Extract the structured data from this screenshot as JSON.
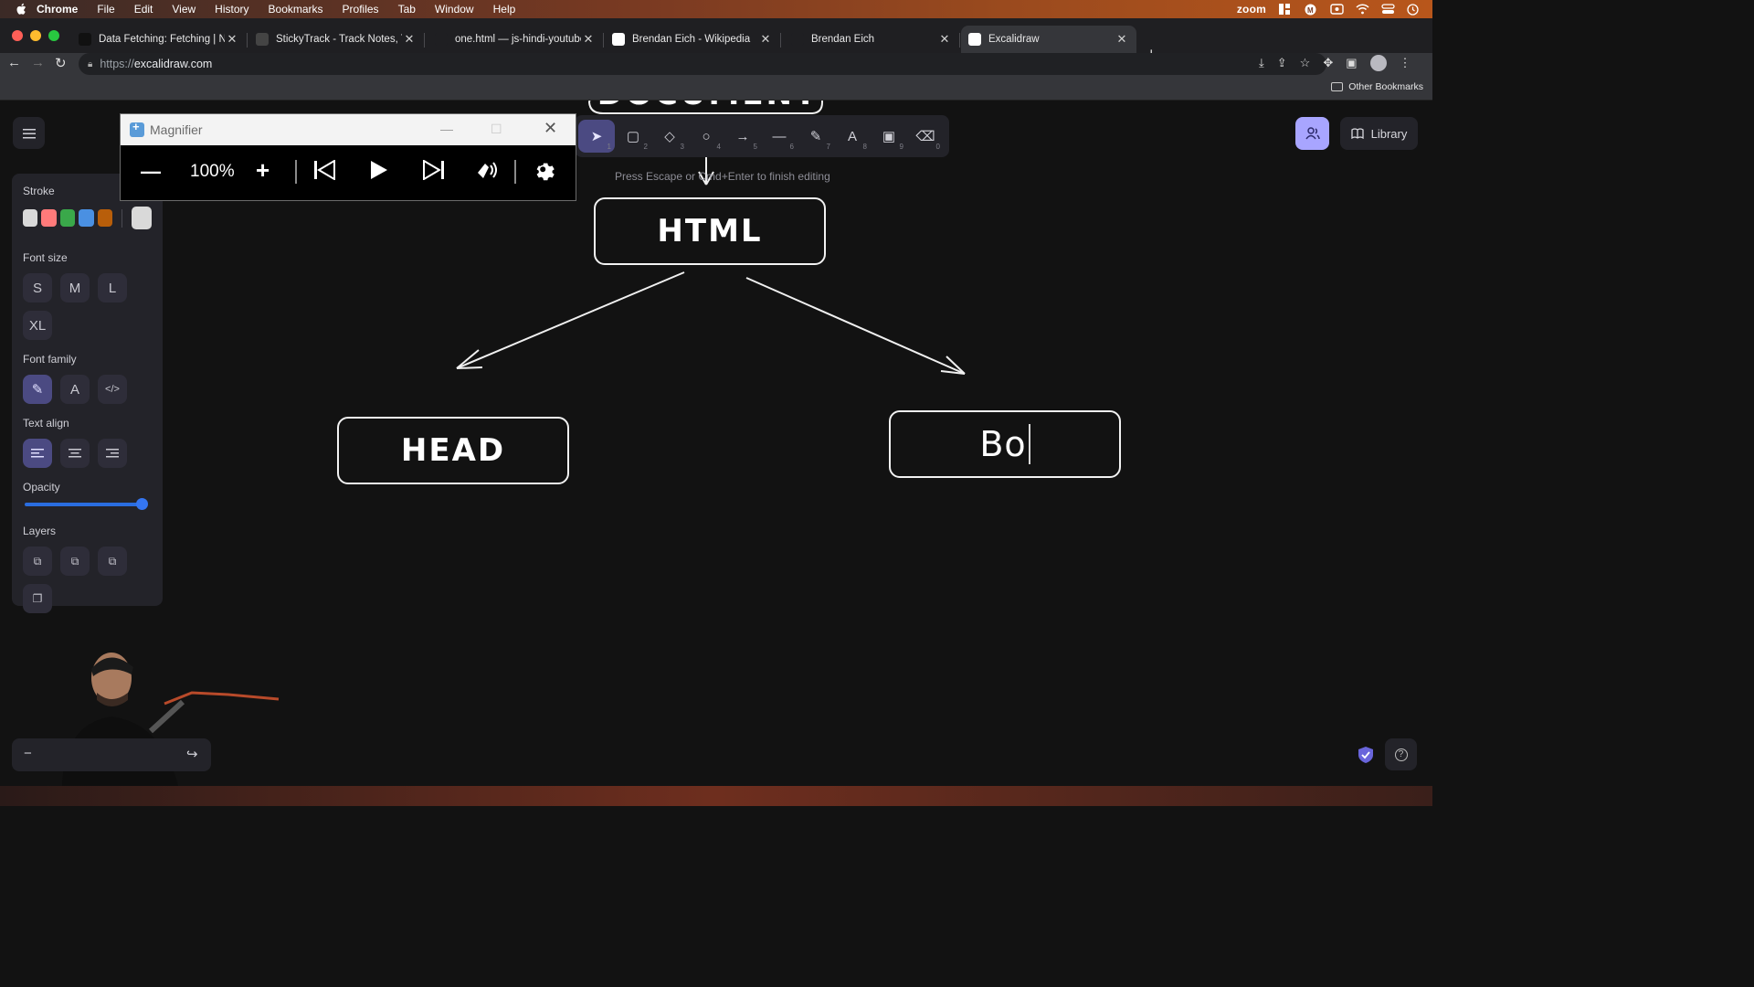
{
  "menubar": {
    "app": "Chrome",
    "items": [
      "File",
      "Edit",
      "View",
      "History",
      "Bookmarks",
      "Profiles",
      "Tab",
      "Window",
      "Help"
    ],
    "right_label": "zoom"
  },
  "tabs": [
    {
      "title": "Data Fetching: Fetching | Next",
      "favicon_color": "#111111",
      "active": false
    },
    {
      "title": "StickyTrack - Track Notes, Trac",
      "favicon_color": "#444444",
      "active": false
    },
    {
      "title": "one.html — js-hindi-youtube [C",
      "favicon_color": "#1f1f22",
      "active": false
    },
    {
      "title": "Brendan Eich - Wikipedia",
      "favicon_color": "#ffffff",
      "active": false
    },
    {
      "title": "Brendan Eich",
      "favicon_color": "#1f1f22",
      "active": false
    },
    {
      "title": "Excalidraw",
      "favicon_color": "#ffffff",
      "active": true
    }
  ],
  "address": {
    "protocol": "https://",
    "host": "excalidraw.com"
  },
  "bookmarks": {
    "other": "Other Bookmarks"
  },
  "properties": {
    "stroke_label": "Stroke",
    "stroke_colors": [
      "#d9d9d9",
      "#ff7a7a",
      "#3aa84a",
      "#4a90e2",
      "#b85e0a"
    ],
    "stroke_current": "#d9d9d9",
    "font_size_label": "Font size",
    "font_sizes": [
      "S",
      "M",
      "L",
      "XL"
    ],
    "font_family_label": "Font family",
    "text_align_label": "Text align",
    "opacity_label": "Opacity",
    "opacity_value": 100,
    "layers_label": "Layers"
  },
  "tools": [
    {
      "name": "selection",
      "key": "1",
      "glyph": "➤"
    },
    {
      "name": "rectangle",
      "key": "2",
      "glyph": "▢"
    },
    {
      "name": "diamond",
      "key": "3",
      "glyph": "◇"
    },
    {
      "name": "ellipse",
      "key": "4",
      "glyph": "○"
    },
    {
      "name": "arrow",
      "key": "5",
      "glyph": "→"
    },
    {
      "name": "line",
      "key": "6",
      "glyph": "—"
    },
    {
      "name": "draw",
      "key": "7",
      "glyph": "✎"
    },
    {
      "name": "text",
      "key": "8",
      "glyph": "A"
    },
    {
      "name": "image",
      "key": "9",
      "glyph": "▣"
    },
    {
      "name": "eraser",
      "key": "0",
      "glyph": "⌫"
    }
  ],
  "hint": "Press Escape or Cmd+Enter to finish editing",
  "library_label": "Library",
  "magnifier": {
    "title": "Magnifier",
    "zoom": "100%"
  },
  "drawing": {
    "top_text": "DOCUMENT",
    "html_label": "HTML",
    "head_label": "HEAD",
    "body_label_editing": "Bo"
  },
  "help_glyph": "?"
}
